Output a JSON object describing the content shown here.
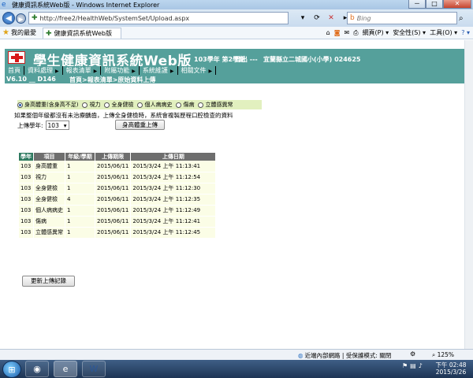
{
  "window": {
    "title": "健康資訊系統Web版 - Windows Internet Explorer",
    "buttons": [
      "－",
      "□",
      "✕"
    ]
  },
  "address_bar": {
    "url": "http://free2/HealthWeb/SystemSet/Upload.aspx",
    "search_placeholder": "Bing"
  },
  "favorites_bar": {
    "favorites_label": "我的最愛",
    "tab_title": "健康資訊系統Web版",
    "commands": {
      "page": "網頁(P) ▾",
      "safety": "安全性(S) ▾",
      "tools": "工具(O) ▾",
      "help": "? ▾"
    }
  },
  "header": {
    "system_title": "學生健康資訊系統Web版",
    "term": "103學年 第2學期",
    "logout": "登出 ---",
    "school": "宜蘭縣立二城國小(小學) 024625",
    "menu": [
      "首頁",
      "資料處理",
      "報表清單",
      "附屬功能",
      "系統維護",
      "相關文件"
    ],
    "version": "V6.10 __ D146",
    "breadcrumb": "首頁>報表清單>原始資料上傳"
  },
  "upload_form": {
    "options": [
      {
        "label": "身高體重(含身高不足)",
        "selected": true
      },
      {
        "label": "視力",
        "selected": false
      },
      {
        "label": "全身健檢",
        "selected": false
      },
      {
        "label": "個人病病史",
        "selected": false
      },
      {
        "label": "傷病",
        "selected": false
      },
      {
        "label": "立體感異常",
        "selected": false
      }
    ],
    "note": "如果整個年級都沒有未治療齲齒，上傳全身健檢時，系統會複製歷程口腔檢查的資料",
    "year_label": "上傳學年:",
    "year_value": "103",
    "upload_button": "身高體重上傳"
  },
  "upload_log": {
    "columns": [
      "學年",
      "項目",
      "年級/學期",
      "上傳期限",
      "上傳日期"
    ],
    "rows": [
      [
        "103",
        "身高體重",
        "1",
        "2015/06/11",
        "2015/3/24 上午 11:13:41"
      ],
      [
        "103",
        "視力",
        "1",
        "2015/06/11",
        "2015/3/24 上午 11:12:54"
      ],
      [
        "103",
        "全身健檢",
        "1",
        "2015/06/11",
        "2015/3/24 上午 11:12:30"
      ],
      [
        "103",
        "全身健檢",
        "4",
        "2015/06/11",
        "2015/3/24 上午 11:12:35"
      ],
      [
        "103",
        "個人病病史",
        "1",
        "2015/06/11",
        "2015/3/24 上午 11:12:49"
      ],
      [
        "103",
        "傷病",
        "1",
        "2015/06/11",
        "2015/3/24 上午 11:12:41"
      ],
      [
        "103",
        "立體感異常",
        "1",
        "2015/06/11",
        "2015/3/24 上午 11:12:45"
      ]
    ],
    "refresh_button": "更新上傳記錄"
  },
  "status_bar": {
    "zone": "近端內部網路 | 受保護模式: 關閉",
    "zoom": "125%"
  },
  "taskbar": {
    "time": "下午 02:48",
    "date": "2015/3/26"
  }
}
